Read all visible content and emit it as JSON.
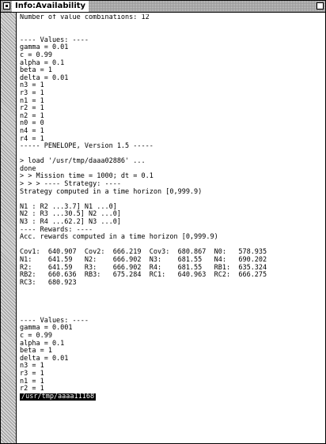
{
  "window": {
    "title": "Info:Availability"
  },
  "log_lines": [
    "Number of value combinations: 12",
    "",
    "",
    "---- Values: ----",
    "gamma = 0.01",
    "c = 0.99",
    "alpha = 0.1",
    "beta = 1",
    "delta = 0.01",
    "n3 = 1",
    "r3 = 1",
    "n1 = 1",
    "r2 = 1",
    "n2 = 1",
    "n0 = 0",
    "n4 = 1",
    "r4 = 1",
    "----- PENELOPE, Version 1.5 -----",
    "",
    "> load '/usr/tmp/daaa02886' ...",
    "done",
    "> > Mission time = 1000; dt = 0.1",
    "> > > ---- Strategy: ----",
    "Strategy computed in a time horizon [0,999.9)",
    "",
    "N1 : R2 ...3.7] N1 ...0]",
    "N2 : R3 ...30.5] N2 ...0]",
    "N3 : R4 ...62.2] N3 ...0]",
    "---- Rewards: ----",
    "Acc. rewards computed in a time horizon [0,999.9)",
    "",
    "Cov1:  640.907  Cov2:  666.219  Cov3:  680.867  N0:   578.935",
    "N1:    641.59   N2:    666.902  N3:    681.55   N4:   690.202",
    "R2:    641.59   R3:    666.902  R4:    681.55   RB1:  635.324",
    "RB2:   660.636  RB3:   675.284  RC1:   640.963  RC2:  666.275",
    "RC3:   680.923",
    "",
    "",
    "",
    "",
    "---- Values: ----",
    "gamma = 0.001",
    "c = 0.99",
    "alpha = 0.1",
    "beta = 1",
    "delta = 0.01",
    "n3 = 1",
    "r3 = 1",
    "n1 = 1",
    "r2 = 1"
  ],
  "status_line": "/usr/tmp/aaaa11168"
}
